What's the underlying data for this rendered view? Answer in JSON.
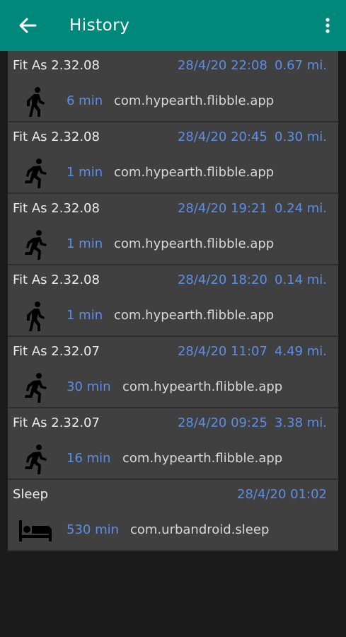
{
  "appbar": {
    "title": "History",
    "back_icon": "arrow-back-icon",
    "menu_icon": "more-vert-icon",
    "color": "#00897b"
  },
  "colors": {
    "accent_text": "#5b8ee6",
    "card_bg": "#404040",
    "page_bg": "#1b1b1b"
  },
  "entries": [
    {
      "name": "Fit As 2.32.08",
      "datetime": "28/4/20 22:08",
      "distance": "0.67 mi.",
      "duration": "6 min",
      "package": "com.hypearth.flibble.app",
      "icon": "walk-icon"
    },
    {
      "name": "Fit As 2.32.08",
      "datetime": "28/4/20 20:45",
      "distance": "0.30 mi.",
      "duration": "1 min",
      "package": "com.hypearth.flibble.app",
      "icon": "run-icon"
    },
    {
      "name": "Fit As 2.32.08",
      "datetime": "28/4/20 19:21",
      "distance": "0.24 mi.",
      "duration": "1 min",
      "package": "com.hypearth.flibble.app",
      "icon": "run-icon"
    },
    {
      "name": "Fit As 2.32.08",
      "datetime": "28/4/20 18:20",
      "distance": "0.14 mi.",
      "duration": "1 min",
      "package": "com.hypearth.flibble.app",
      "icon": "walk-icon"
    },
    {
      "name": "Fit As 2.32.07",
      "datetime": "28/4/20 11:07",
      "distance": "4.49 mi.",
      "duration": "30 min",
      "package": "com.hypearth.flibble.app",
      "icon": "run-icon"
    },
    {
      "name": "Fit As 2.32.07",
      "datetime": "28/4/20 09:25",
      "distance": "3.38 mi.",
      "duration": "16 min",
      "package": "com.hypearth.flibble.app",
      "icon": "run-icon"
    },
    {
      "name": "Sleep",
      "datetime": "28/4/20 01:02",
      "distance": "",
      "duration": "530 min",
      "package": "com.urbandroid.sleep",
      "icon": "bed-icon"
    }
  ]
}
